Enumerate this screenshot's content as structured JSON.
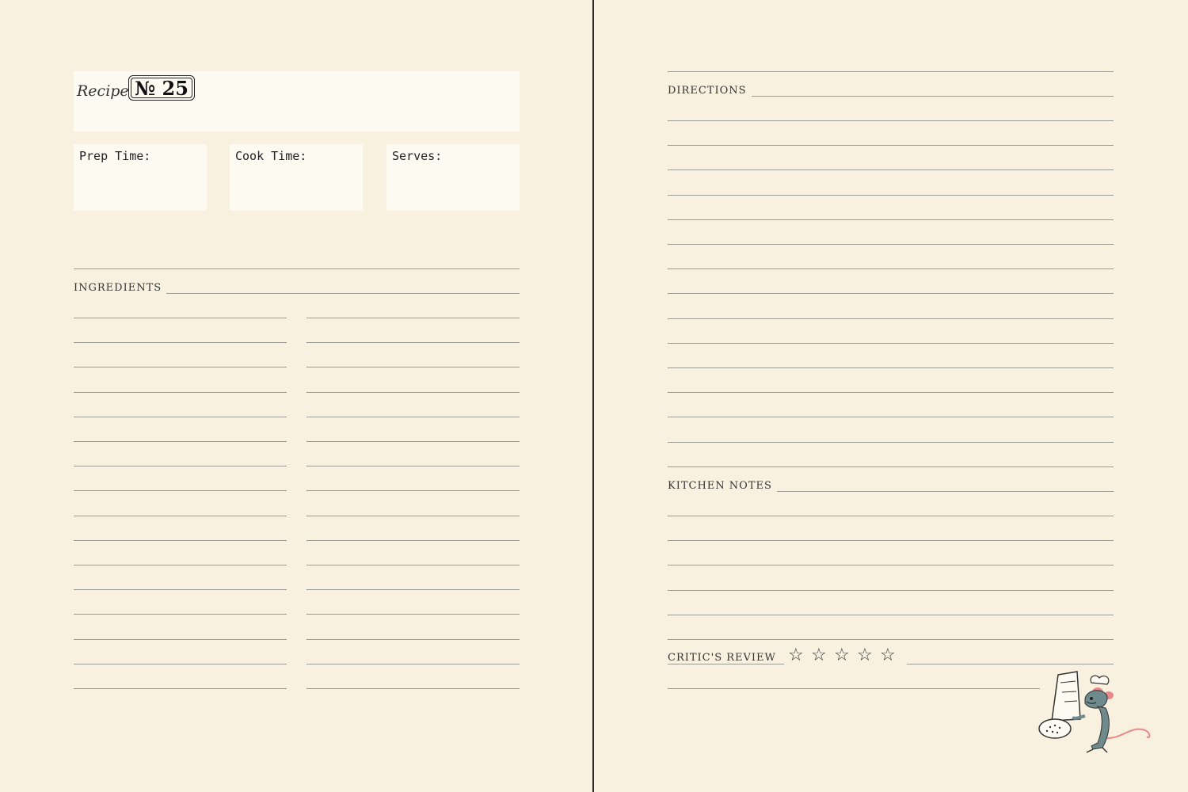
{
  "left_page": {
    "recipe_label": "Recipe",
    "recipe_number": "№ 25",
    "info_boxes": [
      {
        "label": "Prep Time:"
      },
      {
        "label": "Cook Time:"
      },
      {
        "label": "Serves:"
      }
    ],
    "ingredients_label": "INGREDIENTS"
  },
  "right_page": {
    "directions_label": "DIRECTIONS",
    "kitchen_notes_label": "KITCHEN NOTES",
    "critics_review_label": "CRITIC'S REVIEW",
    "rating_stars": [
      "☆",
      "☆",
      "☆",
      "☆",
      "☆"
    ],
    "illustration": "chef-rat-with-salt-shaker"
  },
  "colors": {
    "paper": "#f8f1e0",
    "box": "#fdfaf2",
    "rule": "#9c9a94",
    "gutter": "#2b2b2b"
  }
}
